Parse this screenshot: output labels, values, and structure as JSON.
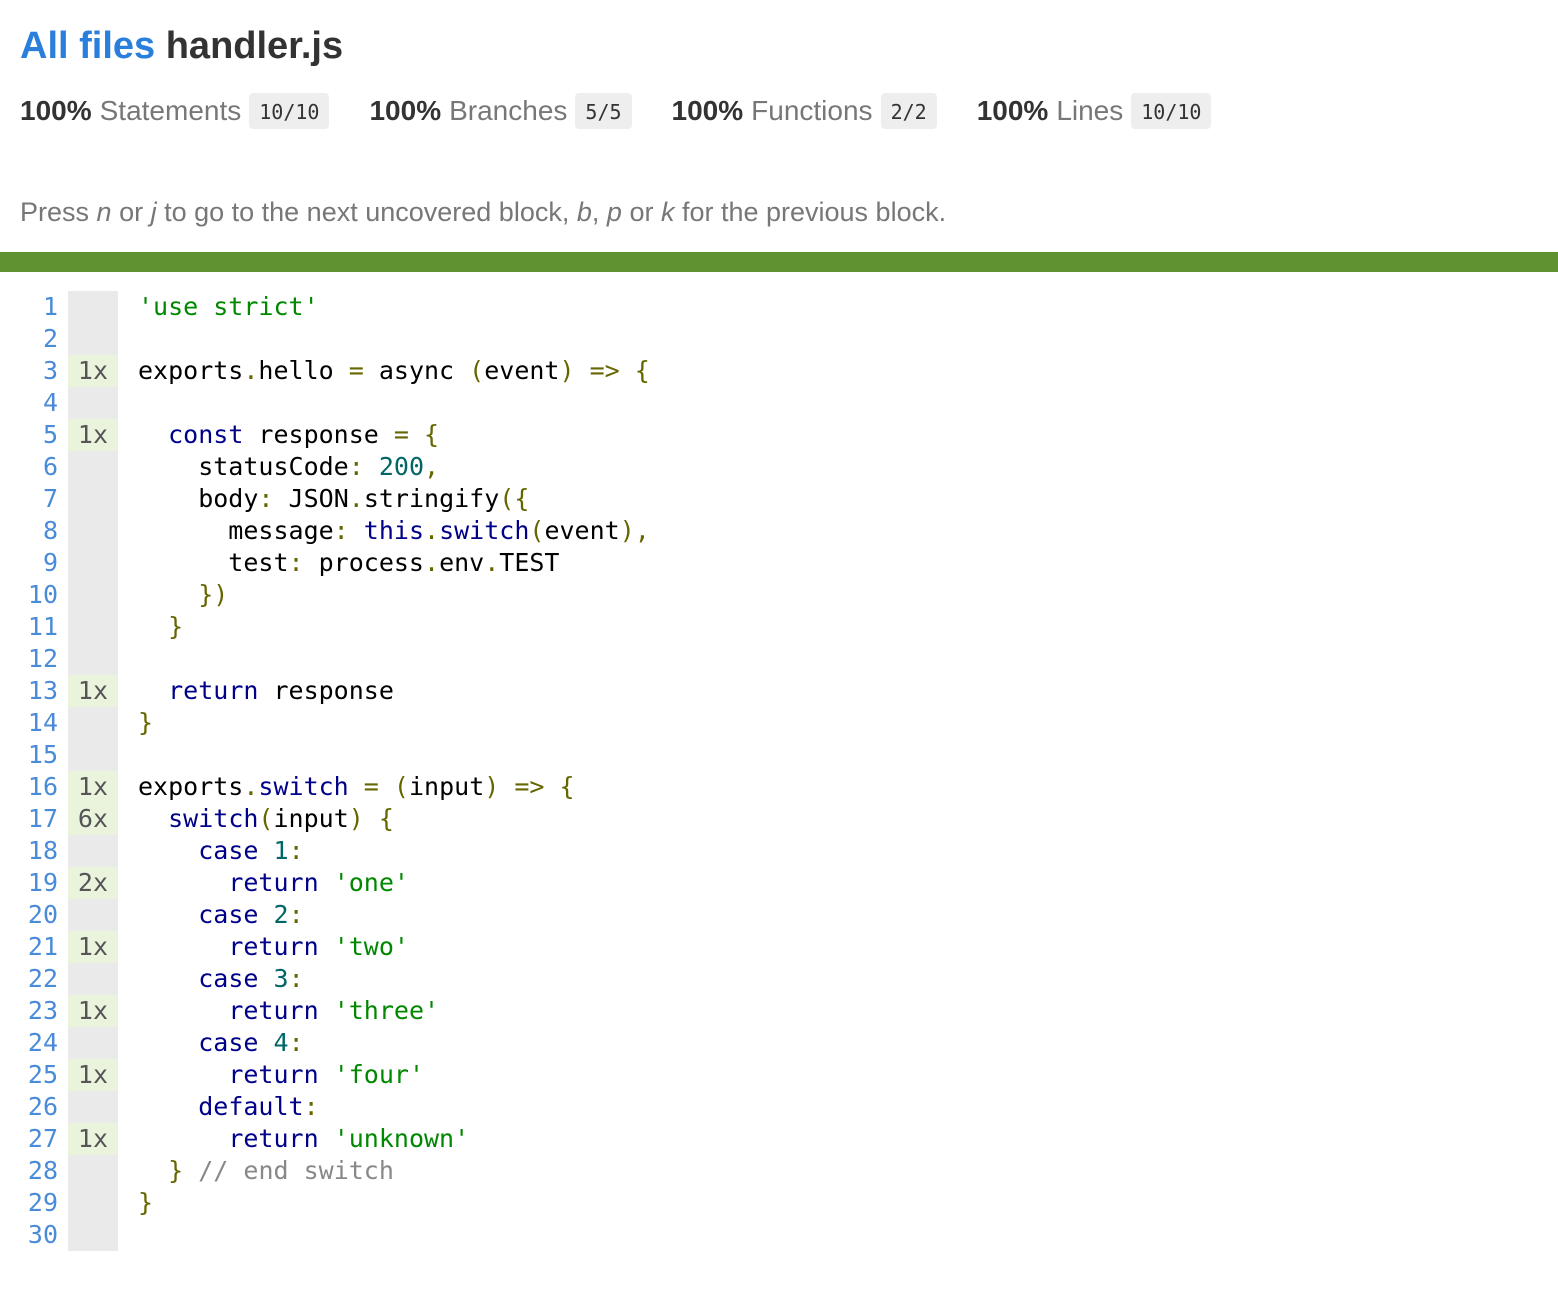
{
  "header": {
    "breadcrumb_link": "All files",
    "file_name": "handler.js"
  },
  "summary": [
    {
      "percent": "100%",
      "label": "Statements",
      "fraction": "10/10"
    },
    {
      "percent": "100%",
      "label": "Branches",
      "fraction": "5/5"
    },
    {
      "percent": "100%",
      "label": "Functions",
      "fraction": "2/2"
    },
    {
      "percent": "100%",
      "label": "Lines",
      "fraction": "10/10"
    }
  ],
  "hint": {
    "press": "Press ",
    "key_n": "n",
    "or1": " or ",
    "key_j": "j",
    "next_text": " to go to the next uncovered block, ",
    "key_b": "b",
    "comma": ", ",
    "key_p": "p",
    "or2": " or ",
    "key_k": "k",
    "prev_text": " for the previous block."
  },
  "status": {
    "coverage_color": "#619232"
  },
  "code_lines": [
    {
      "line": "1",
      "count": "",
      "tokens": [
        [
          "str",
          "'use strict'"
        ]
      ]
    },
    {
      "line": "2",
      "count": "",
      "tokens": []
    },
    {
      "line": "3",
      "count": "1x",
      "tokens": [
        [
          "pln",
          "exports"
        ],
        [
          "pun",
          "."
        ],
        [
          "pln",
          "hello "
        ],
        [
          "pun",
          "="
        ],
        [
          "pln",
          " async "
        ],
        [
          "pun",
          "("
        ],
        [
          "pln",
          "event"
        ],
        [
          "pun",
          ")"
        ],
        [
          "pln",
          " "
        ],
        [
          "pun",
          "=>"
        ],
        [
          "pln",
          " "
        ],
        [
          "pun",
          "{"
        ]
      ]
    },
    {
      "line": "4",
      "count": "",
      "tokens": []
    },
    {
      "line": "5",
      "count": "1x",
      "tokens": [
        [
          "pln",
          "  "
        ],
        [
          "kwd",
          "const"
        ],
        [
          "pln",
          " response "
        ],
        [
          "pun",
          "="
        ],
        [
          "pln",
          " "
        ],
        [
          "pun",
          "{"
        ]
      ]
    },
    {
      "line": "6",
      "count": "",
      "tokens": [
        [
          "pln",
          "    statusCode"
        ],
        [
          "pun",
          ":"
        ],
        [
          "pln",
          " "
        ],
        [
          "num",
          "200"
        ],
        [
          "pun",
          ","
        ]
      ]
    },
    {
      "line": "7",
      "count": "",
      "tokens": [
        [
          "pln",
          "    body"
        ],
        [
          "pun",
          ":"
        ],
        [
          "pln",
          " JSON"
        ],
        [
          "pun",
          "."
        ],
        [
          "pln",
          "stringify"
        ],
        [
          "pun",
          "({"
        ]
      ]
    },
    {
      "line": "8",
      "count": "",
      "tokens": [
        [
          "pln",
          "      message"
        ],
        [
          "pun",
          ":"
        ],
        [
          "pln",
          " "
        ],
        [
          "kwd",
          "this"
        ],
        [
          "pun",
          "."
        ],
        [
          "kwd",
          "switch"
        ],
        [
          "pun",
          "("
        ],
        [
          "pln",
          "event"
        ],
        [
          "pun",
          "),"
        ]
      ]
    },
    {
      "line": "9",
      "count": "",
      "tokens": [
        [
          "pln",
          "      test"
        ],
        [
          "pun",
          ":"
        ],
        [
          "pln",
          " process"
        ],
        [
          "pun",
          "."
        ],
        [
          "pln",
          "env"
        ],
        [
          "pun",
          "."
        ],
        [
          "pln",
          "TEST"
        ]
      ]
    },
    {
      "line": "10",
      "count": "",
      "tokens": [
        [
          "pln",
          "    "
        ],
        [
          "pun",
          "})"
        ]
      ]
    },
    {
      "line": "11",
      "count": "",
      "tokens": [
        [
          "pln",
          "  "
        ],
        [
          "pun",
          "}"
        ]
      ]
    },
    {
      "line": "12",
      "count": "",
      "tokens": []
    },
    {
      "line": "13",
      "count": "1x",
      "tokens": [
        [
          "pln",
          "  "
        ],
        [
          "kwd",
          "return"
        ],
        [
          "pln",
          " response"
        ]
      ]
    },
    {
      "line": "14",
      "count": "",
      "tokens": [
        [
          "pun",
          "}"
        ]
      ]
    },
    {
      "line": "15",
      "count": "",
      "tokens": []
    },
    {
      "line": "16",
      "count": "1x",
      "tokens": [
        [
          "pln",
          "exports"
        ],
        [
          "pun",
          "."
        ],
        [
          "kwd",
          "switch"
        ],
        [
          "pln",
          " "
        ],
        [
          "pun",
          "="
        ],
        [
          "pln",
          " "
        ],
        [
          "pun",
          "("
        ],
        [
          "pln",
          "input"
        ],
        [
          "pun",
          ")"
        ],
        [
          "pln",
          " "
        ],
        [
          "pun",
          "=>"
        ],
        [
          "pln",
          " "
        ],
        [
          "pun",
          "{"
        ]
      ]
    },
    {
      "line": "17",
      "count": "6x",
      "tokens": [
        [
          "pln",
          "  "
        ],
        [
          "kwd",
          "switch"
        ],
        [
          "pun",
          "("
        ],
        [
          "pln",
          "input"
        ],
        [
          "pun",
          ")"
        ],
        [
          "pln",
          " "
        ],
        [
          "pun",
          "{"
        ]
      ]
    },
    {
      "line": "18",
      "count": "",
      "tokens": [
        [
          "pln",
          "    "
        ],
        [
          "kwd",
          "case"
        ],
        [
          "pln",
          " "
        ],
        [
          "num",
          "1"
        ],
        [
          "pun",
          ":"
        ]
      ]
    },
    {
      "line": "19",
      "count": "2x",
      "tokens": [
        [
          "pln",
          "      "
        ],
        [
          "kwd",
          "return"
        ],
        [
          "pln",
          " "
        ],
        [
          "str",
          "'one'"
        ]
      ]
    },
    {
      "line": "20",
      "count": "",
      "tokens": [
        [
          "pln",
          "    "
        ],
        [
          "kwd",
          "case"
        ],
        [
          "pln",
          " "
        ],
        [
          "num",
          "2"
        ],
        [
          "pun",
          ":"
        ]
      ]
    },
    {
      "line": "21",
      "count": "1x",
      "tokens": [
        [
          "pln",
          "      "
        ],
        [
          "kwd",
          "return"
        ],
        [
          "pln",
          " "
        ],
        [
          "str",
          "'two'"
        ]
      ]
    },
    {
      "line": "22",
      "count": "",
      "tokens": [
        [
          "pln",
          "    "
        ],
        [
          "kwd",
          "case"
        ],
        [
          "pln",
          " "
        ],
        [
          "num",
          "3"
        ],
        [
          "pun",
          ":"
        ]
      ]
    },
    {
      "line": "23",
      "count": "1x",
      "tokens": [
        [
          "pln",
          "      "
        ],
        [
          "kwd",
          "return"
        ],
        [
          "pln",
          " "
        ],
        [
          "str",
          "'three'"
        ]
      ]
    },
    {
      "line": "24",
      "count": "",
      "tokens": [
        [
          "pln",
          "    "
        ],
        [
          "kwd",
          "case"
        ],
        [
          "pln",
          " "
        ],
        [
          "num",
          "4"
        ],
        [
          "pun",
          ":"
        ]
      ]
    },
    {
      "line": "25",
      "count": "1x",
      "tokens": [
        [
          "pln",
          "      "
        ],
        [
          "kwd",
          "return"
        ],
        [
          "pln",
          " "
        ],
        [
          "str",
          "'four'"
        ]
      ]
    },
    {
      "line": "26",
      "count": "",
      "tokens": [
        [
          "pln",
          "    "
        ],
        [
          "kwd",
          "default"
        ],
        [
          "pun",
          ":"
        ]
      ]
    },
    {
      "line": "27",
      "count": "1x",
      "tokens": [
        [
          "pln",
          "      "
        ],
        [
          "kwd",
          "return"
        ],
        [
          "pln",
          " "
        ],
        [
          "str",
          "'unknown'"
        ]
      ]
    },
    {
      "line": "28",
      "count": "",
      "tokens": [
        [
          "pln",
          "  "
        ],
        [
          "pun",
          "}"
        ],
        [
          "pln",
          " "
        ],
        [
          "cmt",
          "// end switch"
        ]
      ]
    },
    {
      "line": "29",
      "count": "",
      "tokens": [
        [
          "pun",
          "}"
        ]
      ]
    },
    {
      "line": "30",
      "count": "",
      "tokens": []
    }
  ]
}
